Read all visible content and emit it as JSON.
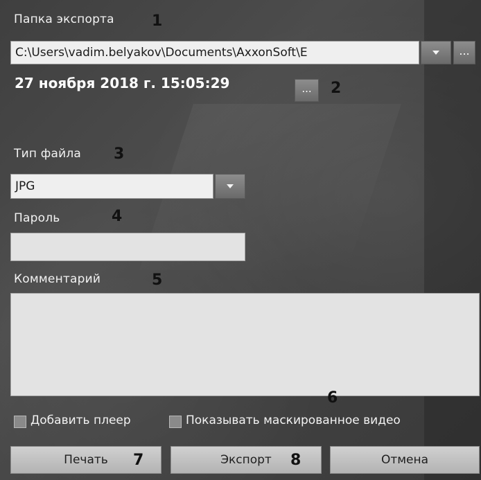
{
  "export_folder": {
    "label": "Папка экспорта",
    "marker": "1",
    "path": "C:\\Users\\vadim.belyakov\\Documents\\AxxonSoft\\E",
    "browse_label": "..."
  },
  "timestamp": {
    "value": "27 ноября 2018 г. 15:05:29",
    "edit_label": "...",
    "marker": "2"
  },
  "file_type": {
    "label": "Тип файла",
    "marker": "3",
    "selected": "JPG"
  },
  "password": {
    "label": "Пароль",
    "marker": "4",
    "value": ""
  },
  "comment": {
    "label": "Комментарий",
    "marker": "5",
    "value": ""
  },
  "options": {
    "marker": "6",
    "add_player_label": "Добавить плеер",
    "show_masked_label": "Показывать маскированное видео"
  },
  "buttons": {
    "print_label": "Печать",
    "print_marker": "7",
    "export_label": "Экспорт",
    "export_marker": "8",
    "cancel_label": "Отмена"
  }
}
